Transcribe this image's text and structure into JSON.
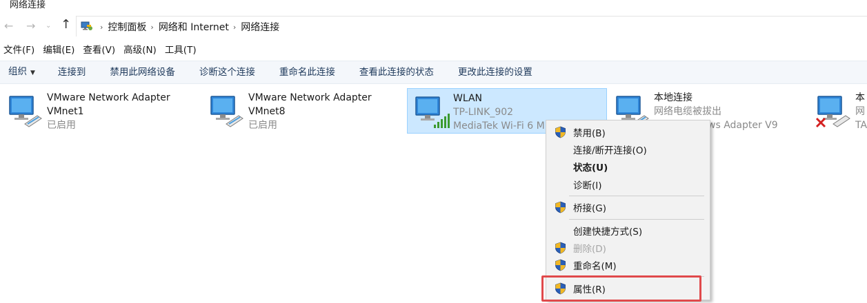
{
  "window": {
    "title": "网络连接"
  },
  "address": {
    "breadcrumbs": [
      "控制面板",
      "网络和 Internet",
      "网络连接"
    ]
  },
  "menubar": {
    "items": [
      "文件(F)",
      "编辑(E)",
      "查看(V)",
      "高级(N)",
      "工具(T)"
    ]
  },
  "commandbar": {
    "organize": "组织",
    "items": [
      "连接到",
      "禁用此网络设备",
      "诊断这个连接",
      "重命名此连接",
      "查看此连接的状态",
      "更改此连接的设置"
    ]
  },
  "adapters": [
    {
      "line1": "VMware Network Adapter",
      "line2": "VMnet1",
      "line3": "已启用",
      "icon": "network-adapter-icon"
    },
    {
      "line1": "VMware Network Adapter",
      "line2": "VMnet8",
      "line3": "已启用",
      "icon": "network-adapter-icon"
    },
    {
      "line1": "WLAN",
      "line2": "TP-LINK_902",
      "line3": "MediaTek Wi-Fi 6 M",
      "icon": "wifi-adapter-icon",
      "selected": true
    },
    {
      "line1": "本地连接",
      "line2": "网络电缆被拔出",
      "line3": "ws Adapter V9",
      "icon": "network-adapter-icon"
    },
    {
      "line1": "本",
      "line2": "网",
      "line3": "TA",
      "icon": "network-adapter-disconnected-icon"
    }
  ],
  "context_menu": {
    "items": [
      {
        "label": "禁用(B)",
        "shield": true
      },
      {
        "label": "连接/断开连接(O)"
      },
      {
        "label": "状态(U)",
        "bold": true
      },
      {
        "label": "诊断(I)"
      },
      {
        "label": "桥接(G)",
        "shield": true
      },
      {
        "label": "创建快捷方式(S)"
      },
      {
        "label": "删除(D)",
        "shield": true,
        "disabled": true
      },
      {
        "label": "重命名(M)",
        "shield": true
      },
      {
        "label": "属性(R)",
        "shield": true,
        "highlighted": true
      }
    ]
  },
  "colors": {
    "selection_bg": "#cce8ff",
    "selection_border": "#99d1ff",
    "highlight_frame": "#e0494b",
    "command_text": "#1e395b"
  }
}
